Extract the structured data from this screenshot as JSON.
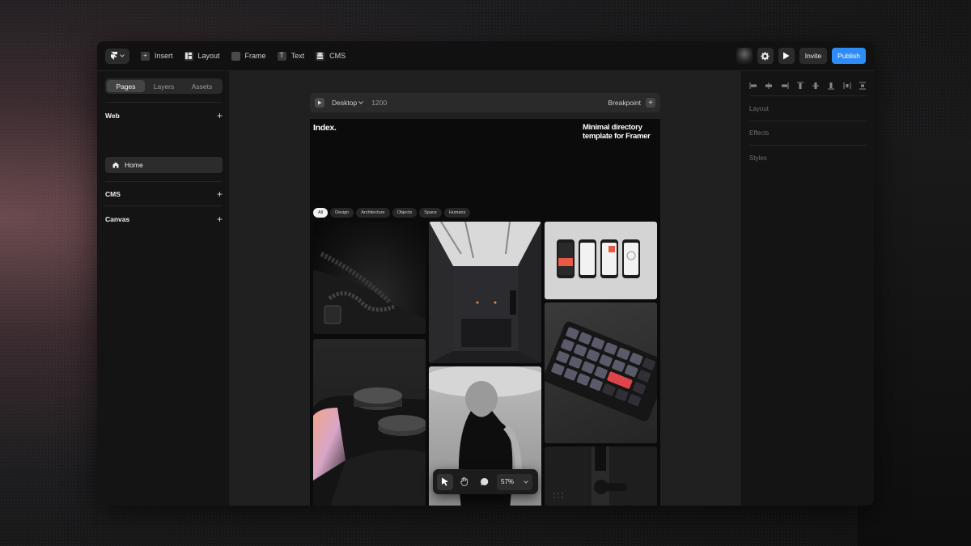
{
  "toolbar": {
    "insert_label": "Insert",
    "layout_label": "Layout",
    "frame_label": "Frame",
    "text_label": "Text",
    "cms_label": "CMS",
    "invite_label": "Invite",
    "publish_label": "Publish",
    "publish_color": "#2f8bf5"
  },
  "left_panel": {
    "tabs": [
      {
        "label": "Pages",
        "active": true
      },
      {
        "label": "Layers",
        "active": false
      },
      {
        "label": "Assets",
        "active": false
      }
    ],
    "sections": {
      "web": "Web",
      "cms": "CMS",
      "canvas": "Canvas"
    },
    "pages": [
      {
        "label": "Home",
        "icon": "home-icon"
      }
    ]
  },
  "canvas": {
    "device_label": "Desktop",
    "width_value": "1200",
    "breakpoint_label": "Breakpoint",
    "site": {
      "title": "Index.",
      "subtitle": "Minimal directory template for Framer",
      "filters": [
        "All",
        "Design",
        "Architecture",
        "Objects",
        "Space",
        "Humans"
      ],
      "active_filter": "All"
    },
    "zoom_label": "57%"
  },
  "right_panel": {
    "layout_label": "Layout",
    "effects_label": "Effects",
    "styles_label": "Styles"
  }
}
